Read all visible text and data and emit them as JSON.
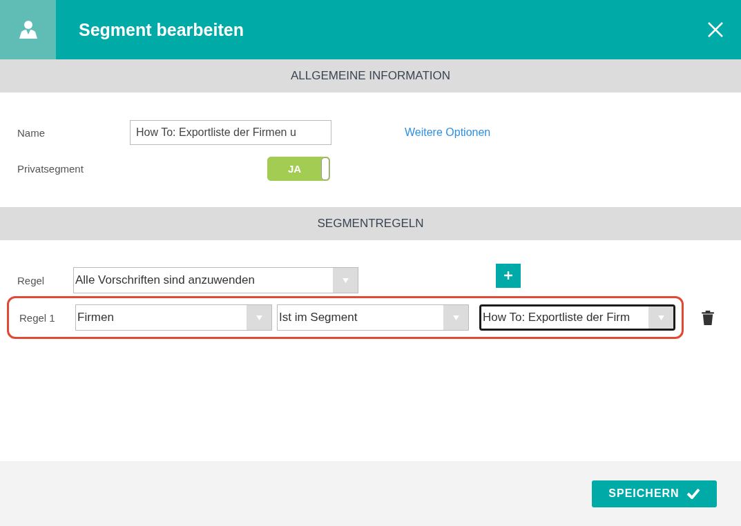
{
  "window": {
    "title": "Segment bearbeiten"
  },
  "general": {
    "heading": "ALLGEMEINE INFORMATION",
    "name": {
      "label": "Name",
      "value": "How To: Exportliste der Firmen u"
    },
    "more_options": "Weitere Optionen",
    "private": {
      "label": "Privatsegment",
      "on": true,
      "text": "JA"
    }
  },
  "rules": {
    "heading": "SEGMENTREGELN",
    "mode": {
      "label": "Regel",
      "value": "Alle Vorschriften sind anzuwenden"
    },
    "items": [
      {
        "label": "Regel 1",
        "highlighted": true,
        "selects": [
          {
            "value": "Firmen",
            "focused": false
          },
          {
            "value": "Ist im Segment",
            "focused": false
          },
          {
            "value": "How To: Exportliste der Firm",
            "focused": true
          }
        ]
      }
    ]
  },
  "footer": {
    "save": "SPEICHERN"
  }
}
